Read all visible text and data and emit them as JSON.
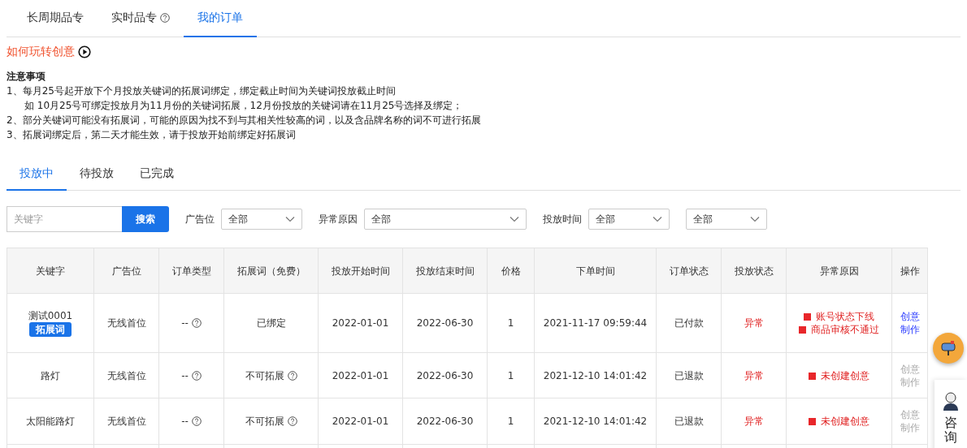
{
  "top_tabs": [
    {
      "label": "长周期品专",
      "selected": false,
      "help": false
    },
    {
      "label": "实时品专",
      "selected": false,
      "help": true
    },
    {
      "label": "我的订单",
      "selected": true,
      "help": false
    }
  ],
  "guide_link": {
    "label": "如何玩转创意"
  },
  "notice": {
    "title": "注意事项",
    "lines": [
      {
        "kind": "item",
        "text": "1、每月25号起开放下个月投放关键词的拓展词绑定，绑定截止时间为关键词投放截止时间"
      },
      {
        "kind": "note",
        "text": "如 10月25号可绑定投放月为11月份的关键词拓展，12月份投放的关键词请在11月25号选择及绑定；"
      },
      {
        "kind": "item",
        "text": "2、部分关键词可能没有拓展词，可能的原因为找不到与其相关性较高的词，以及含品牌名称的词不可进行拓展"
      },
      {
        "kind": "item",
        "text": "3、拓展词绑定后，第二天才能生效，请于投放开始前绑定好拓展词"
      }
    ]
  },
  "sub_tabs": [
    {
      "label": "投放中",
      "selected": true
    },
    {
      "label": "待投放",
      "selected": false
    },
    {
      "label": "已完成",
      "selected": false
    }
  ],
  "filters": {
    "keyword": {
      "placeholder": "关键字"
    },
    "search_button": "搜索",
    "selects": [
      {
        "label": "广告位",
        "value": "全部"
      },
      {
        "label": "异常原因",
        "value": "全部"
      },
      {
        "label": "投放时间",
        "value": "全部"
      },
      {
        "value": "全部"
      }
    ]
  },
  "table": {
    "columns": [
      "关键字",
      "广告位",
      "订单类型",
      "拓展词（免费）",
      "投放开始时间",
      "投放结束时间",
      "价格",
      "下单时间",
      "订单状态",
      "投放状态",
      "异常原因",
      "操作"
    ],
    "rows": [
      {
        "keyword": "测试0001",
        "tag": "拓展词",
        "ad_position": "无线首位",
        "order_type": "--",
        "extension": {
          "text": "已绑定",
          "help": false
        },
        "start": "2022-01-01",
        "end": "2022-06-30",
        "price": "1",
        "order_time": "2021-11-17 09:59:44",
        "order_status": "已付款",
        "delivery_status": "异常",
        "reasons": [
          "账号状态下线",
          "商品审核不通过"
        ],
        "action": {
          "label": "创意制作",
          "disabled": false
        }
      },
      {
        "keyword": "路灯",
        "ad_position": "无线首位",
        "order_type": "--",
        "extension": {
          "text": "不可拓展",
          "help": true
        },
        "start": "2022-01-01",
        "end": "2022-06-30",
        "price": "1",
        "order_time": "2021-12-10 14:01:42",
        "order_status": "已退款",
        "delivery_status": "异常",
        "reasons": [
          "未创建创意"
        ],
        "action": {
          "label": "创意制作",
          "disabled": true
        }
      },
      {
        "keyword": "太阳能路灯",
        "ad_position": "无线首位",
        "order_type": "--",
        "extension": {
          "text": "不可拓展",
          "help": true
        },
        "start": "2022-01-01",
        "end": "2022-06-30",
        "price": "1",
        "order_time": "2021-12-10 14:01:42",
        "order_status": "已退款",
        "delivery_status": "异常",
        "reasons": [
          "未创建创意"
        ],
        "action": {
          "label": "创意制作",
          "disabled": true
        }
      }
    ]
  },
  "consult_panel": {
    "label": "咨询"
  }
}
